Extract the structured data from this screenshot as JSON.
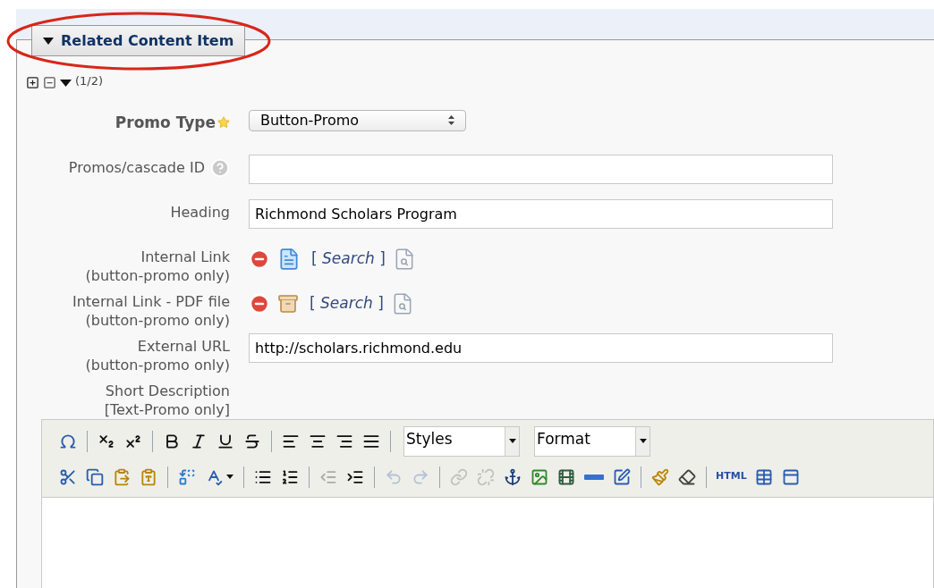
{
  "section": {
    "title": "Related Content Item",
    "expanded": true,
    "highlighted": true
  },
  "item_controls": {
    "counter": "(1/2)"
  },
  "fields": [
    {
      "kind": "select",
      "label": "Promo Type",
      "required": true,
      "value": "Button-Promo"
    },
    {
      "kind": "text",
      "label": "Promos/cascade ID",
      "help": true
    },
    {
      "kind": "text",
      "label": "Heading",
      "value": "Richmond Scholars Program"
    },
    {
      "kind": "chooser",
      "label": "Internal Link",
      "note": "(button-promo only)",
      "pdf": false,
      "search": "[ *Search* ]"
    },
    {
      "kind": "chooser",
      "label": "Internal Link - PDF file",
      "note": "(button-promo only)",
      "pdf": true,
      "search": "[ *Search* ]"
    },
    {
      "kind": "text",
      "label": "External URL",
      "note": "(button-promo only)",
      "value": "http://scholars.richmond.edu"
    },
    {
      "kind": "label",
      "label": "Short Description",
      "note": "[Text-Promo only]"
    }
  ],
  "editor": {
    "toolbar_rows": [
      [
        {
          "kind": "omega"
        },
        {
          "kind": "sep"
        },
        {
          "kind": "subscript"
        },
        {
          "kind": "superscript"
        },
        {
          "kind": "sep"
        },
        {
          "kind": "bold"
        },
        {
          "kind": "italic"
        },
        {
          "kind": "underline"
        },
        {
          "kind": "strike"
        },
        {
          "kind": "sep"
        },
        {
          "kind": "align-left"
        },
        {
          "kind": "align-center"
        },
        {
          "kind": "align-right"
        },
        {
          "kind": "justify"
        },
        {
          "kind": "sep"
        },
        {
          "kind": "dropdown",
          "label": "Styles"
        },
        {
          "kind": "dropdown",
          "label": "Format"
        }
      ],
      [
        {
          "kind": "cut"
        },
        {
          "kind": "copy"
        },
        {
          "kind": "paste"
        },
        {
          "kind": "paste-text"
        },
        {
          "kind": "sep"
        },
        {
          "kind": "replace"
        },
        {
          "kind": "spellcheck"
        },
        {
          "kind": "sep"
        },
        {
          "kind": "bullets"
        },
        {
          "kind": "numbers"
        },
        {
          "kind": "sep"
        },
        {
          "kind": "outdent",
          "disabled": true
        },
        {
          "kind": "indent",
          "disabled": false
        },
        {
          "kind": "sep"
        },
        {
          "kind": "undo",
          "disabled": true
        },
        {
          "kind": "redo",
          "disabled": true
        },
        {
          "kind": "sep"
        },
        {
          "kind": "link",
          "disabled": true
        },
        {
          "kind": "unlink",
          "disabled": true
        },
        {
          "kind": "anchor",
          "disabled": false
        },
        {
          "kind": "image"
        },
        {
          "kind": "media"
        },
        {
          "kind": "rule"
        },
        {
          "kind": "edit-table"
        },
        {
          "kind": "sep"
        },
        {
          "kind": "brush"
        },
        {
          "kind": "eraser"
        },
        {
          "kind": "sep"
        },
        {
          "kind": "text",
          "label": "HTML"
        },
        {
          "kind": "table"
        },
        {
          "kind": "panel"
        }
      ]
    ]
  }
}
